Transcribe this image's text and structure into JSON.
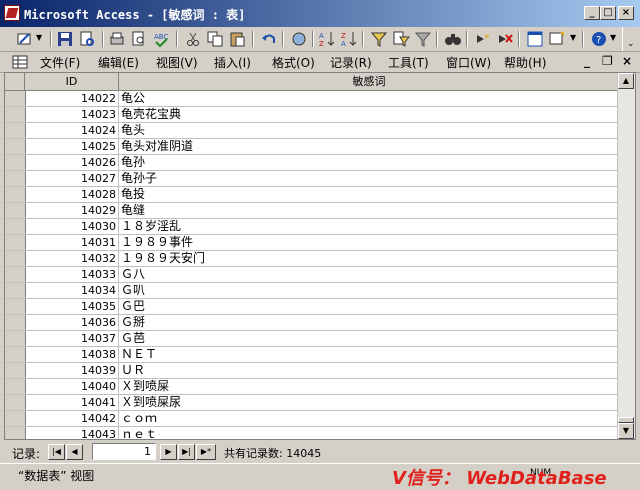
{
  "window": {
    "title": "Microsoft Access - [敏感词 : 表]",
    "buttons": {
      "minimize": "_",
      "maximize": "□",
      "close": "×"
    }
  },
  "menu": {
    "items": [
      "文件(F)",
      "编辑(E)",
      "视图(V)",
      "插入(I)",
      "格式(O)",
      "记录(R)",
      "工具(T)",
      "窗口(W)",
      "帮助(H)"
    ],
    "doc_buttons": {
      "minimize": "_",
      "restore": "❐",
      "close": "×"
    }
  },
  "table": {
    "columns": [
      "ID",
      "敏感词"
    ],
    "rows": [
      {
        "id": "14022",
        "word": "龟公"
      },
      {
        "id": "14023",
        "word": "龟壳花宝典"
      },
      {
        "id": "14024",
        "word": "龟头"
      },
      {
        "id": "14025",
        "word": "龟头对准阴道"
      },
      {
        "id": "14026",
        "word": "龟孙"
      },
      {
        "id": "14027",
        "word": "龟孙子"
      },
      {
        "id": "14028",
        "word": "龟投"
      },
      {
        "id": "14029",
        "word": "龟缝"
      },
      {
        "id": "14030",
        "word": "１８岁淫乱"
      },
      {
        "id": "14031",
        "word": "１９８９事件"
      },
      {
        "id": "14032",
        "word": "１９８９天安门"
      },
      {
        "id": "14033",
        "word": "Ｇ八"
      },
      {
        "id": "14034",
        "word": "Ｇ叭"
      },
      {
        "id": "14035",
        "word": "Ｇ巴"
      },
      {
        "id": "14036",
        "word": "Ｇ掰"
      },
      {
        "id": "14037",
        "word": "Ｇ芭"
      },
      {
        "id": "14038",
        "word": "ＮＥＴ"
      },
      {
        "id": "14039",
        "word": "ＵＲ"
      },
      {
        "id": "14040",
        "word": "Ｘ到喷屎"
      },
      {
        "id": "14041",
        "word": "Ｘ到喷屎尿"
      },
      {
        "id": "14042",
        "word": "ｃｏｍ"
      },
      {
        "id": "14043",
        "word": "ｎｅｔ"
      }
    ]
  },
  "navigator": {
    "label": "记录:",
    "current": "1",
    "total_text": "共有记录数: 14045"
  },
  "status": {
    "view": "“数据表” 视图",
    "num": "NUM",
    "watermark": "V信号： WebDataBase"
  },
  "colors": {
    "title_start": "#0a246a",
    "title_end": "#a6caf0",
    "watermark": "#e0201a"
  }
}
